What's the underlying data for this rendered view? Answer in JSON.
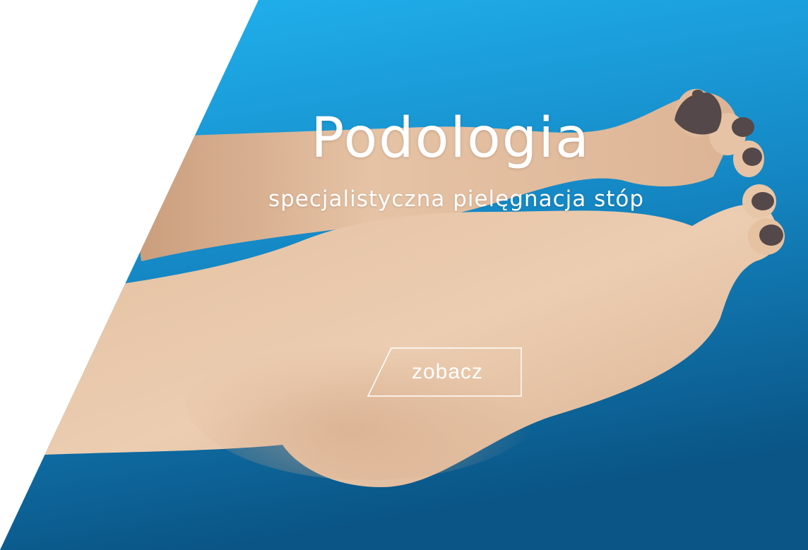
{
  "hero": {
    "title": "Podologia",
    "subtitle": "specjalistyczna pielęgnacja stóp",
    "cta_label": "zobacz",
    "image_subject": "bare-feet-photo"
  },
  "colors": {
    "background_left": "#ffffff",
    "blue_top": "#21b2ee",
    "blue_bottom": "#0a5a8a",
    "skin": "#e8c5a6",
    "nail_polish": "#55484a",
    "text": "#ffffff"
  }
}
